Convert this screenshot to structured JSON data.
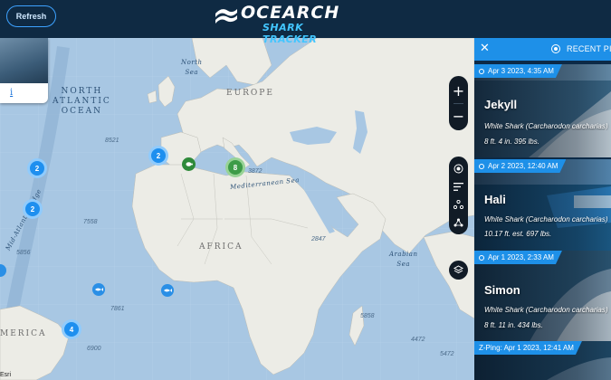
{
  "header": {
    "refresh_label": "Refresh",
    "logo_title": "OCEARCH",
    "logo_subtitle": "SHARK TRACKER"
  },
  "popup": {
    "info_link": "i"
  },
  "map": {
    "labels": {
      "north_sea": "North\nSea",
      "europe": "EUROPE",
      "north_atlantic": "NORTH\nATLANTIC\nOCEAN",
      "africa": "AFRICA",
      "arabian_sea": "Arabian\nSea",
      "mid_atlantic_ridge": "Mid-Atlantic Ridge",
      "mediterranean": "Mediterranean Sea",
      "america": "MERICA"
    },
    "depths": [
      "8521",
      "7558",
      "2847",
      "5858",
      "5856",
      "7861",
      "6900",
      "4472",
      "5472",
      "3872"
    ],
    "clusters": {
      "c1": "2",
      "c2": "2",
      "c3": "2",
      "c4": "8",
      "c5": "4"
    },
    "attribution": "Esri"
  },
  "controls": {
    "zoom_in": "+",
    "zoom_out": "−"
  },
  "sidebar": {
    "close": "✕",
    "header_label": "RECENT PINGS",
    "cards": [
      {
        "date": "Apr 3 2023, 4:35 AM",
        "name": "Jekyll",
        "species": "White Shark (Carcharodon carcharias)",
        "size": "8 ft. 4 in. 395 lbs."
      },
      {
        "date": "Apr 2 2023, 12:40 AM",
        "name": "Hali",
        "species": "White Shark (Carcharodon carcharias)",
        "size": "10.17 ft. est. 697 lbs."
      },
      {
        "date": "Apr 1 2023, 2:33 AM",
        "name": "Simon",
        "species": "White Shark (Carcharodon carcharias)",
        "size": "8 ft. 11 in. 434 lbs."
      },
      {
        "date": "Z-Ping: Apr 1 2023, 12:41 AM",
        "name": "",
        "species": "",
        "size": ""
      }
    ]
  },
  "colors": {
    "accent": "#1e90e8",
    "header_bg": "#0f2a43",
    "cluster_blue": "#1e8fef",
    "cluster_green": "#3d9c48"
  }
}
